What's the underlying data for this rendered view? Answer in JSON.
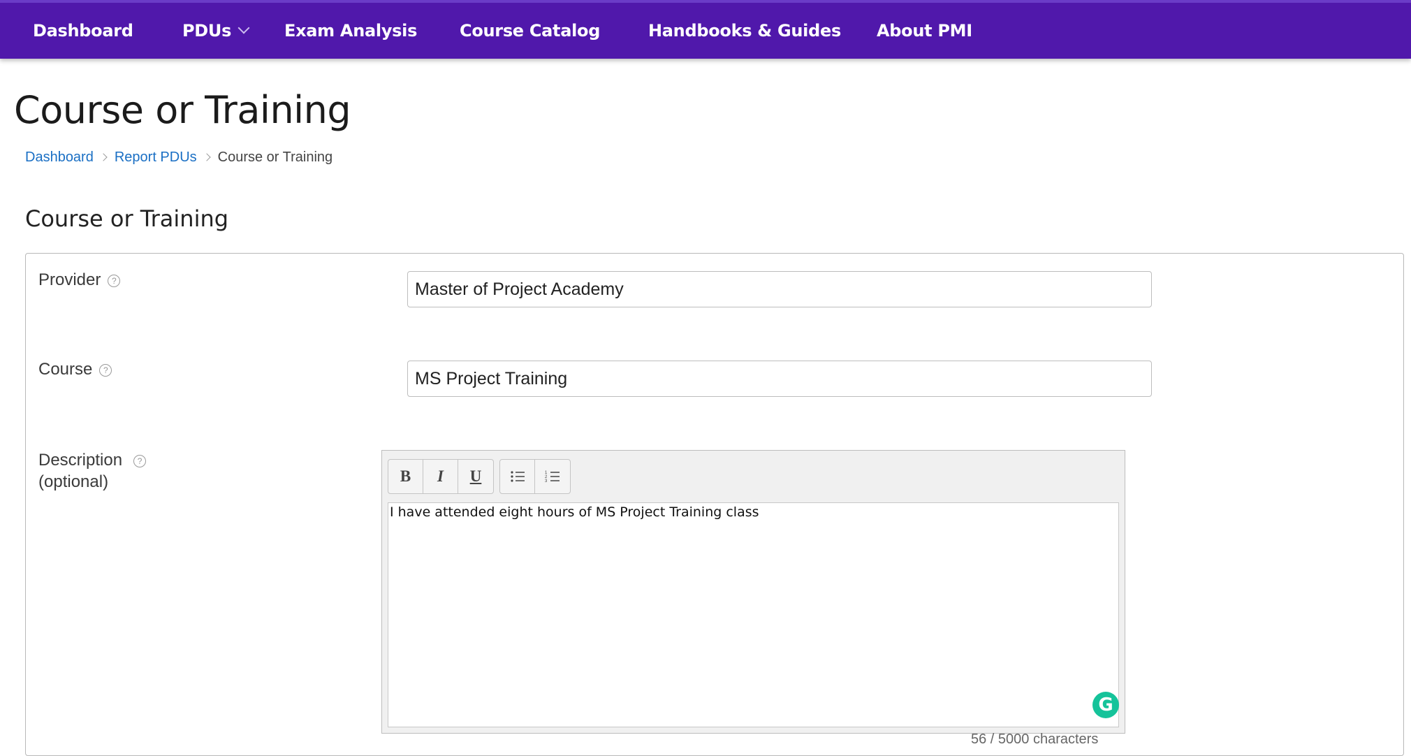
{
  "nav": {
    "items": [
      {
        "label": "Dashboard"
      },
      {
        "label": "PDUs"
      },
      {
        "label": "Exam Analysis"
      },
      {
        "label": "Course Catalog"
      },
      {
        "label": "Handbooks & Guides"
      },
      {
        "label": "About PMI"
      }
    ]
  },
  "page": {
    "title": "Course or Training"
  },
  "breadcrumb": {
    "items": [
      "Dashboard",
      "Report PDUs"
    ],
    "current": "Course or Training"
  },
  "form": {
    "section_title": "Course or Training",
    "provider": {
      "label": "Provider",
      "value": "Master of Project Academy"
    },
    "course": {
      "label": "Course",
      "value": "MS Project Training"
    },
    "description": {
      "label": "Description",
      "optional": "(optional)",
      "value": "I have attended eight hours of MS Project Training class",
      "char_count": "56 / 5000 characters"
    },
    "toolbar": {
      "bold": "B",
      "italic": "I",
      "underline": "U"
    },
    "help_glyph": "?",
    "grammarly_glyph": "G"
  }
}
